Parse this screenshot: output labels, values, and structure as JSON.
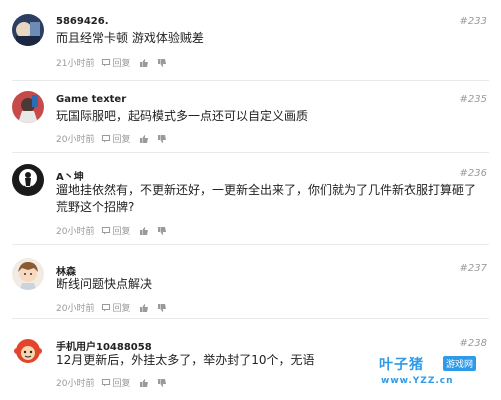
{
  "comments": [
    {
      "username": "5869426.",
      "floor": "#233",
      "content": "而且经常卡顿 游戏体验贼差",
      "time": "21小时前",
      "reply": "回复"
    },
    {
      "username": "Game texter",
      "floor": "#235",
      "content": "玩国际服吧，起码模式多一点还可以自定义画质",
      "time": "20小时前",
      "reply": "回复"
    },
    {
      "username": "A丶坤",
      "floor": "#236",
      "content": "遛地挂依然有，不更新还好，一更新全出来了，你们就为了几件新衣服打算砸了荒野这个招牌?",
      "time": "20小时前",
      "reply": "回复"
    },
    {
      "username": "林森",
      "floor": "#237",
      "content": "断线问题快点解决",
      "time": "20小时前",
      "reply": "回复"
    },
    {
      "username": "手机用户10488058",
      "floor": "#238",
      "content": "12月更新后，外挂太多了，举办封了10个，无语",
      "time": "20小时前",
      "reply": "回复"
    }
  ],
  "watermark": {
    "title": "叶子猪",
    "badge": "游戏网",
    "url": "www.YZZ.cn"
  },
  "colors": {
    "accent": "#2f9be8",
    "muted": "#9a9a9a",
    "divider": "#e9e9e9"
  }
}
